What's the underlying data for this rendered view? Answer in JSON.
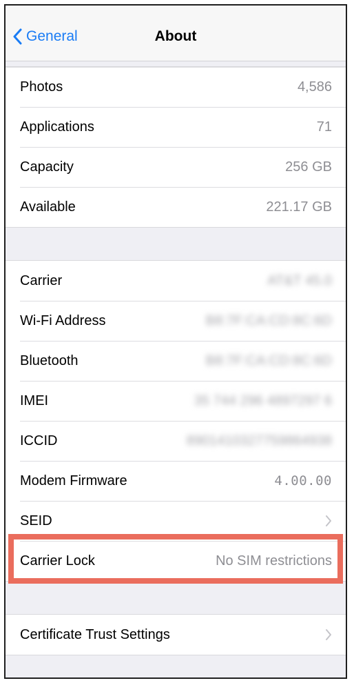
{
  "nav": {
    "back_label": "General",
    "title": "About"
  },
  "storage": [
    {
      "label": "Photos",
      "value": "4,586"
    },
    {
      "label": "Applications",
      "value": "71"
    },
    {
      "label": "Capacity",
      "value": "256 GB"
    },
    {
      "label": "Available",
      "value": "221.17 GB"
    }
  ],
  "network": {
    "carrier": {
      "label": "Carrier",
      "value": "AT&T 45.0"
    },
    "wifi": {
      "label": "Wi-Fi Address",
      "value": "B8:7F:CA:CD:8C:6D"
    },
    "bluetooth": {
      "label": "Bluetooth",
      "value": "B8:7F:CA:CD:8C:6D"
    },
    "imei": {
      "label": "IMEI",
      "value": "35 744 296 4897297 6"
    },
    "iccid": {
      "label": "ICCID",
      "value": "8901410327759864938"
    },
    "modem": {
      "label": "Modem Firmware",
      "value": "4.00.00"
    },
    "seid": {
      "label": "SEID"
    },
    "carrier_lock": {
      "label": "Carrier Lock",
      "value": "No SIM restrictions"
    }
  },
  "certificate": {
    "label": "Certificate Trust Settings"
  },
  "colors": {
    "accent": "#1a7cf5",
    "highlight": "#ea6d5d"
  }
}
